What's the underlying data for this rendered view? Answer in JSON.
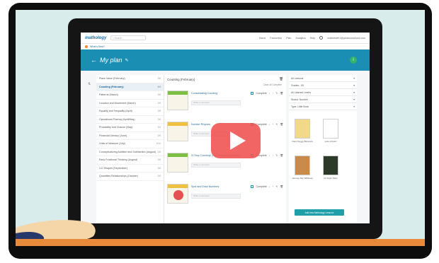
{
  "app": {
    "logo": "mathology",
    "search_placeholder": "Search",
    "nav": [
      "Home",
      "Favourites",
      "Plan",
      "Analytics",
      "Help"
    ],
    "user_email": "mathtester1@pearsonschool.com",
    "whats_new": "What's New?"
  },
  "plan": {
    "title": "My plan",
    "months": [
      {
        "label": "Place Value (February)",
        "count": "0/6"
      },
      {
        "label": "Counting (February)",
        "count": "0/4"
      },
      {
        "label": "Patterns (March)",
        "count": "0/6"
      },
      {
        "label": "Location and Movement (March)",
        "count": "0/5"
      },
      {
        "label": "Equality and Inequality (April)",
        "count": "0/5"
      },
      {
        "label": "Operational Fluency (April/May)",
        "count": "0/6"
      },
      {
        "label": "Probability and Chance (May)",
        "count": "0/4"
      },
      {
        "label": "Financial Literacy (June)",
        "count": "0/5"
      },
      {
        "label": "Units of Measure (July)",
        "count": "0/10"
      },
      {
        "label": "Conceptualizing Addition and Subtraction (August)",
        "count": "0/6"
      },
      {
        "label": "Early Fractional Thinking (August)",
        "count": "0/5"
      },
      {
        "label": "2-D Shapes (September)",
        "count": "0/5"
      },
      {
        "label": "Quantities Relationships (October)",
        "count": "0/5"
      }
    ],
    "active_month_index": 1
  },
  "middle": {
    "heading": "Counting (February)",
    "sub": "Clear all Complete",
    "lessons": [
      {
        "name": "Consolidating Counting",
        "complete": "Complete",
        "note": "Write a comment"
      },
      {
        "name": "Number Rhymes",
        "complete": "Complete",
        "note": "Write a comment"
      },
      {
        "name": "I'll Stop Counting! (Not Counting Workmats)",
        "complete": "Complete",
        "note": "Write a comment"
      },
      {
        "name": "Spot and Draw Numbers",
        "complete": "Complete",
        "note": "Write a comment"
      }
    ]
  },
  "right": {
    "filters": [
      "All Lessons",
      "Grades - 05",
      "All Learned Levels",
      "Strand: Number",
      "Type: Little Book"
    ],
    "books": [
      "Giant Soggy Bonanza",
      "Lots of Dots!",
      "Journey Sky Wildness",
      "Art Night Party"
    ],
    "add_button": "Add new Mathology Lessons"
  },
  "colors": {
    "brand": "#1b8fb3",
    "play": "#f05050",
    "accent_orange": "#e98a3a",
    "scene_bg": "#d9ecec"
  }
}
